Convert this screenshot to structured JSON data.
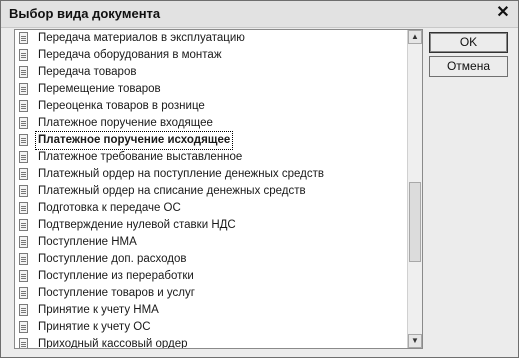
{
  "dialog": {
    "title": "Выбор вида документа",
    "close_glyph": "✕",
    "ok_label": "OK",
    "cancel_label": "Отмена"
  },
  "list": {
    "selected_index": 6,
    "items": [
      "Передача материалов в эксплуатацию",
      "Передача оборудования в монтаж",
      "Передача товаров",
      "Перемещение товаров",
      "Переоценка товаров в рознице",
      "Платежное поручение входящее",
      "Платежное поручение исходящее",
      "Платежное требование выставленное",
      "Платежный ордер на поступление денежных средств",
      "Платежный ордер на списание денежных средств",
      "Подготовка к передаче ОС",
      "Подтверждение нулевой ставки НДС",
      "Поступление НМА",
      "Поступление доп. расходов",
      "Поступление из переработки",
      "Поступление товаров и услуг",
      "Принятие к учету НМА",
      "Принятие к учету ОС",
      "Приходный кассовый ордер"
    ],
    "item_icon": "document-icon"
  },
  "scrollbar": {
    "up_glyph": "▲",
    "down_glyph": "▼"
  }
}
